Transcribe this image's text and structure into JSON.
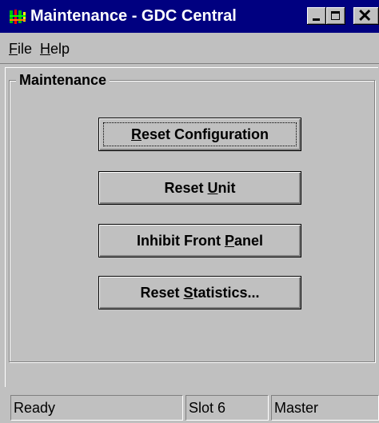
{
  "window": {
    "title": "Maintenance - GDC Central",
    "icon": "gdc-app-icon",
    "controls": [
      "minimize-icon",
      "maximize-icon",
      "close-icon"
    ],
    "title_bar_color": "#000080"
  },
  "menu": {
    "file": {
      "underlined": "F",
      "rest": "ile"
    },
    "help": {
      "underlined": "H",
      "rest": "elp"
    }
  },
  "group": {
    "label": "Maintenance"
  },
  "buttons": {
    "reset_configuration": {
      "underlined": "R",
      "rest": "eset Configuration"
    },
    "reset_unit": {
      "before": "Reset ",
      "underlined": "U",
      "rest": "nit"
    },
    "inhibit_front_panel": {
      "before": "Inhibit Front ",
      "underlined": "P",
      "rest": "anel"
    },
    "reset_statistics": {
      "before": "Reset ",
      "underlined": "S",
      "rest": "tatistics..."
    }
  },
  "status": {
    "state": "Ready",
    "slot": "Slot 6",
    "role": "Master"
  }
}
